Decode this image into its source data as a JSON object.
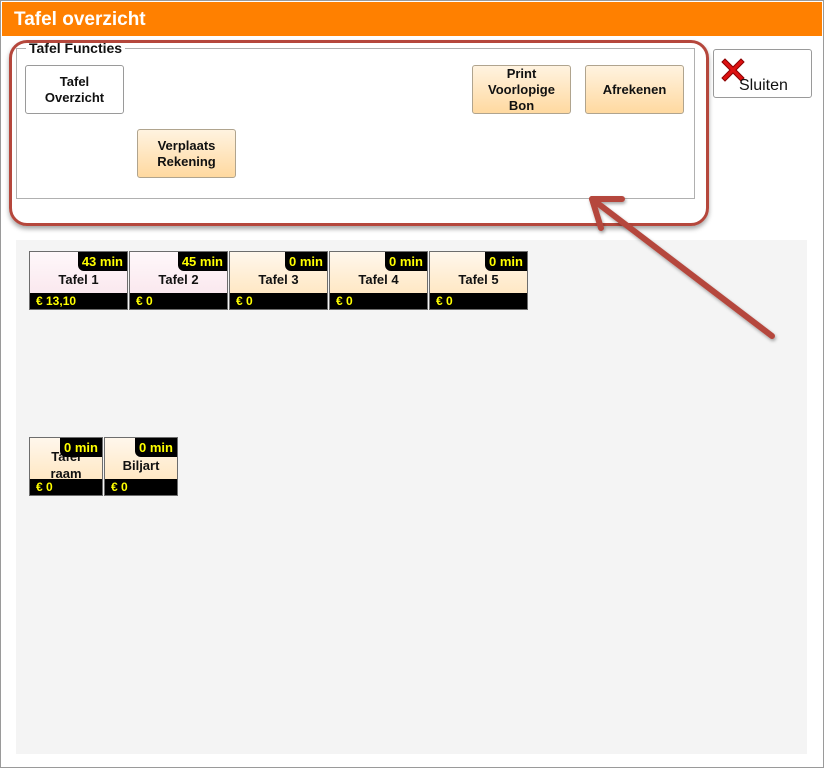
{
  "window": {
    "title": "Tafel overzicht"
  },
  "functions": {
    "legend": "Tafel Functies",
    "buttons": {
      "overview": "Tafel\nOverzicht",
      "print": "Print\nVoorlopige\nBon",
      "checkout": "Afrekenen",
      "move": "Verplaats\nRekening"
    }
  },
  "close": {
    "label": "Sluiten",
    "icon": "close-x-icon",
    "icon_color": "#dd1111"
  },
  "tables_row1": [
    {
      "name": "Tafel 1",
      "time": "43 min",
      "amount": "€ 13,10",
      "status": "occupied"
    },
    {
      "name": "Tafel 2",
      "time": "45 min",
      "amount": "€ 0",
      "status": "occupied"
    },
    {
      "name": "Tafel 3",
      "time": "0 min",
      "amount": "€ 0",
      "status": "free"
    },
    {
      "name": "Tafel 4",
      "time": "0 min",
      "amount": "€ 0",
      "status": "free"
    },
    {
      "name": "Tafel 5",
      "time": "0 min",
      "amount": "€ 0",
      "status": "free"
    }
  ],
  "tables_row2": [
    {
      "name": "Tafel\nraam",
      "time": "0 min",
      "amount": "€ 0",
      "status": "free"
    },
    {
      "name": "Biljart",
      "time": "0 min",
      "amount": "€ 0",
      "status": "free"
    }
  ],
  "colors": {
    "titlebar": "#ff8000",
    "highlight": "#b5473c",
    "label_text": "#ffff00"
  }
}
